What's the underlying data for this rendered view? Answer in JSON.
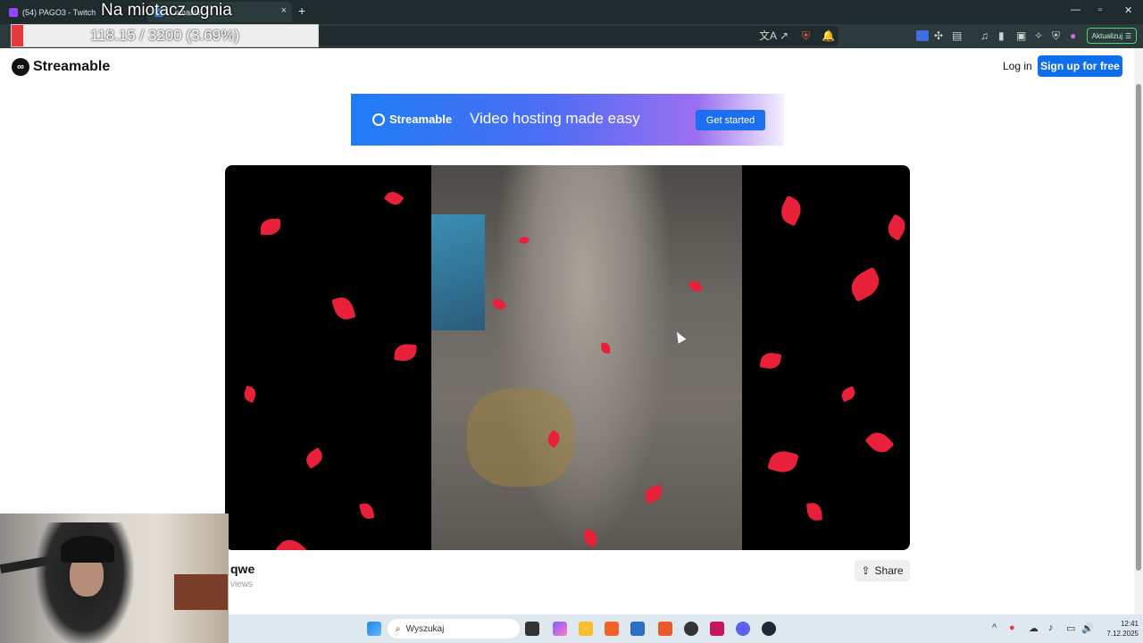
{
  "browser": {
    "tabs": [
      {
        "label": "(54) PAGO3 - Twitch",
        "icon_color": "#9146ff",
        "active": false
      },
      {
        "label": "...amable",
        "icon_color": "#3b8cf0",
        "active": true
      }
    ],
    "update_button": "Aktualizuj"
  },
  "overlay": {
    "stream_title": "Na miotacz ognia",
    "donation_text": "118.15 / 3200 (3.69%)",
    "donation_progress_pct": 3.69,
    "fill_color": "#e8383c"
  },
  "header": {
    "logo": "Streamable",
    "login": "Log in",
    "signup": "Sign up for free"
  },
  "banner": {
    "brand": "Streamable",
    "tagline": "Video hosting made easy",
    "cta": "Get started"
  },
  "video": {
    "title": "qwe",
    "views": "views",
    "share": "Share"
  },
  "taskbar": {
    "search_placeholder": "Wyszukaj",
    "time": "12:41",
    "date": "7.12.2025"
  },
  "icons": {
    "translate": "文A",
    "share_out": "↗",
    "shield": "⛨",
    "bell": "🔔",
    "music": "♫",
    "sidebar": "▮",
    "wallet": "▣",
    "leo": "✧",
    "vpn": "⛨",
    "menu": "☰",
    "share": "⇪",
    "search": "⌕",
    "up": "^",
    "wifi": "◌",
    "cloud": "☁",
    "mic": "♪",
    "monitor": "▭",
    "speaker": "🔊"
  }
}
